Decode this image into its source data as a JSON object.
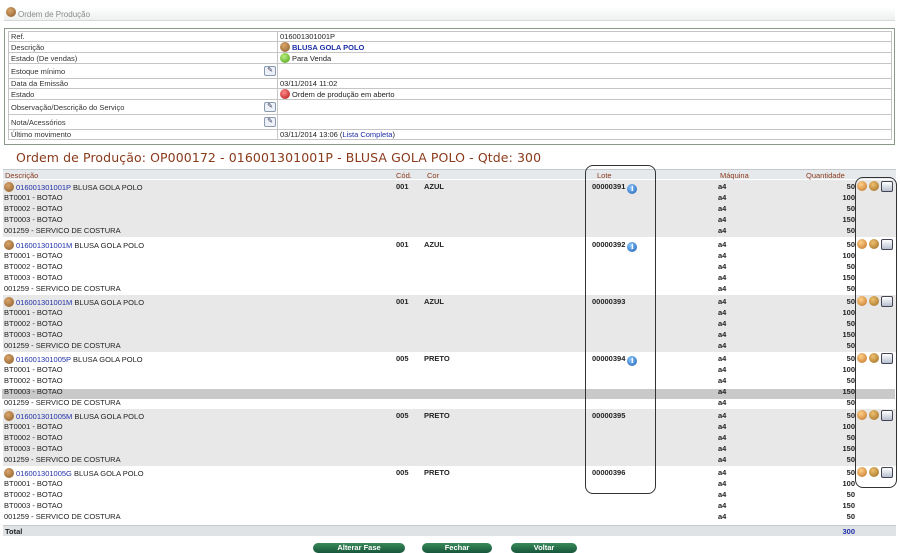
{
  "header": {
    "title": "Ordem de Produção"
  },
  "info": {
    "rows": [
      {
        "label": "Ref.",
        "value": "016001301001P"
      },
      {
        "label": "Descrição",
        "value": "BLUSA GOLA POLO"
      },
      {
        "label": "Estado (De vendas)",
        "value": "Para Venda"
      },
      {
        "label": "Estoque mínimo",
        "value": ""
      },
      {
        "label": "Data da Emissão",
        "value": "03/11/2014 11:02"
      },
      {
        "label": "Estado",
        "value": "Ordem de produção em aberto"
      },
      {
        "label": "Observação/Descrição do Serviço",
        "value": ""
      },
      {
        "label": "Nota/Acessórios",
        "value": ""
      },
      {
        "label": "Último movimento",
        "value": "03/11/2014 13:06 (",
        "link": "Lista Completa",
        "suffix": ")"
      }
    ]
  },
  "order_title": "Ordem de Produção: OP000172 - 016001301001P - BLUSA GOLA POLO - Qtde: 300",
  "table": {
    "headers": {
      "descricao": "Descrição",
      "cod": "Cód.",
      "cor": "Cor",
      "lote": "Lote",
      "maquina": "Máquina",
      "quantidade": "Quantidade"
    },
    "groups": [
      {
        "code": "016001301001P",
        "name": "BLUSA GOLA POLO",
        "cod": "001",
        "cor": "AZUL",
        "lote": "00000391",
        "has_info": true,
        "maquina": "a4",
        "qty": "50",
        "components": [
          {
            "name": "BT0001 - BOTAO",
            "maquina": "a4",
            "qty": "100"
          },
          {
            "name": "BT0002 - BOTAO",
            "maquina": "a4",
            "qty": "50"
          },
          {
            "name": "BT0003 - BOTAO",
            "maquina": "a4",
            "qty": "150"
          },
          {
            "name": "001259 - SERVICO DE COSTURA",
            "maquina": "a4",
            "qty": "50"
          }
        ]
      },
      {
        "code": "016001301001M",
        "name": "BLUSA GOLA POLO",
        "cod": "001",
        "cor": "AZUL",
        "lote": "00000392",
        "has_info": true,
        "maquina": "a4",
        "qty": "50",
        "components": [
          {
            "name": "BT0001 - BOTAO",
            "maquina": "a4",
            "qty": "100"
          },
          {
            "name": "BT0002 - BOTAO",
            "maquina": "a4",
            "qty": "50"
          },
          {
            "name": "BT0003 - BOTAO",
            "maquina": "a4",
            "qty": "150"
          },
          {
            "name": "001259 - SERVICO DE COSTURA",
            "maquina": "a4",
            "qty": "50"
          }
        ]
      },
      {
        "code": "016001301001M",
        "name": "BLUSA GOLA POLO",
        "cod": "001",
        "cor": "AZUL",
        "lote": "00000393",
        "has_info": false,
        "maquina": "a4",
        "qty": "50",
        "components": [
          {
            "name": "BT0001 - BOTAO",
            "maquina": "a4",
            "qty": "100"
          },
          {
            "name": "BT0002 - BOTAO",
            "maquina": "a4",
            "qty": "50"
          },
          {
            "name": "BT0003 - BOTAO",
            "maquina": "a4",
            "qty": "150"
          },
          {
            "name": "001259 - SERVICO DE COSTURA",
            "maquina": "a4",
            "qty": "50"
          }
        ]
      },
      {
        "code": "016001301005P",
        "name": "BLUSA GOLA POLO",
        "cod": "005",
        "cor": "PRETO",
        "lote": "00000394",
        "has_info": true,
        "maquina": "a4",
        "qty": "50",
        "components": [
          {
            "name": "BT0001 - BOTAO",
            "maquina": "a4",
            "qty": "100"
          },
          {
            "name": "BT0002 - BOTAO",
            "maquina": "a4",
            "qty": "50"
          },
          {
            "name": "BT0003 - BOTAO",
            "maquina": "a4",
            "qty": "150"
          },
          {
            "name": "001259 - SERVICO DE COSTURA",
            "maquina": "a4",
            "qty": "50"
          }
        ]
      },
      {
        "code": "016001301005M",
        "name": "BLUSA GOLA POLO",
        "cod": "005",
        "cor": "PRETO",
        "lote": "00000395",
        "has_info": false,
        "maquina": "a4",
        "qty": "50",
        "components": [
          {
            "name": "BT0001 - BOTAO",
            "maquina": "a4",
            "qty": "100"
          },
          {
            "name": "BT0002 - BOTAO",
            "maquina": "a4",
            "qty": "50"
          },
          {
            "name": "BT0003 - BOTAO",
            "maquina": "a4",
            "qty": "150"
          },
          {
            "name": "001259 - SERVICO DE COSTURA",
            "maquina": "a4",
            "qty": "50"
          }
        ]
      },
      {
        "code": "016001301005G",
        "name": "BLUSA GOLA POLO",
        "cod": "005",
        "cor": "PRETO",
        "lote": "00000396",
        "has_info": false,
        "maquina": "a4",
        "qty": "50",
        "components": [
          {
            "name": "BT0001 - BOTAO",
            "maquina": "a4",
            "qty": "100"
          },
          {
            "name": "BT0002 - BOTAO",
            "maquina": "a4",
            "qty": "50"
          },
          {
            "name": "BT0003 - BOTAO",
            "maquina": "a4",
            "qty": "150"
          },
          {
            "name": "001259 - SERVICO DE COSTURA",
            "maquina": "a4",
            "qty": "50"
          }
        ]
      }
    ],
    "total_label": "Total",
    "total_value": "300"
  },
  "buttons": {
    "alterar": "Alterar Fase",
    "fechar": "Fechar",
    "voltar": "Voltar"
  },
  "colors": {
    "accent_title": "#8a3a1a",
    "link": "#1d2fa8",
    "button": "#16563a"
  }
}
